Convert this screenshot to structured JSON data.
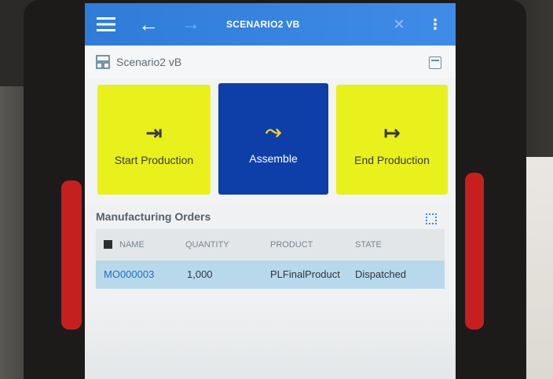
{
  "app_bar": {
    "title": "SCENARIO2 VB",
    "menu_icon": "hamburger-menu-icon",
    "back_icon": "arrow-left-icon",
    "forward_icon": "arrow-right-icon",
    "close_icon": "close-icon",
    "more_icon": "more-vertical-icon",
    "color": "#3a86e3"
  },
  "sub_header": {
    "title": "Scenario2 vB",
    "left_icon": "layout-grid-icon",
    "right_icon": "panel-icon"
  },
  "tiles": [
    {
      "label": "Start Production",
      "icon": "arrow-to-bar-icon",
      "glyph": "⇥",
      "color": "#e9f11c"
    },
    {
      "label": "Assemble",
      "icon": "merge-arrow-icon",
      "glyph": "⤳",
      "color": "#0e3fa8"
    },
    {
      "label": "End Production",
      "icon": "arrow-from-bar-icon",
      "glyph": "↦",
      "color": "#e9f11c"
    }
  ],
  "orders": {
    "title": "Manufacturing Orders",
    "expand_icon": "expand-icon",
    "columns": [
      "NAME",
      "QUANTITY",
      "PRODUCT",
      "STATE"
    ],
    "rows": [
      {
        "name": "MO000003",
        "quantity": "1,000",
        "product": "PLFinalProduct",
        "state": "Dispatched"
      }
    ]
  }
}
